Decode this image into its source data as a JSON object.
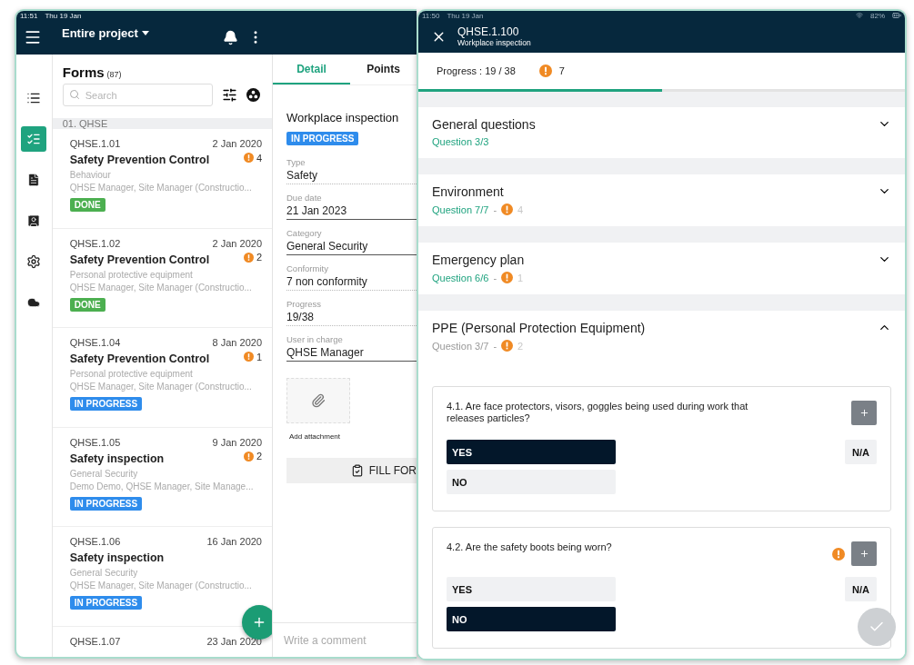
{
  "left_device": {
    "status_bar": {
      "time": "11:51",
      "date": "Thu 19 Jan"
    },
    "header": {
      "project": "Entire project"
    },
    "rail": [
      {
        "kind": "list",
        "selected": false
      },
      {
        "kind": "checklist",
        "selected": true
      },
      {
        "kind": "document",
        "selected": false
      },
      {
        "kind": "contact",
        "selected": false
      },
      {
        "kind": "settings",
        "selected": false
      },
      {
        "kind": "cloud",
        "selected": false
      }
    ],
    "forms": {
      "title": "Forms",
      "count": "(87)",
      "search": {
        "placeholder": "Search"
      },
      "group": "01. QHSE",
      "items": [
        {
          "code": "QHSE.1.01",
          "date": "2 Jan 2020",
          "title": "Safety Prevention Control",
          "warnings": "4",
          "category": "Behaviour",
          "assignees": "QHSE Manager, Site Manager (Constructio...",
          "status": {
            "kind": "done",
            "label": "DONE"
          }
        },
        {
          "code": "QHSE.1.02",
          "date": "2 Jan 2020",
          "title": "Safety Prevention Control",
          "warnings": "2",
          "category": "Personal protective equipment",
          "assignees": "QHSE Manager, Site Manager (Constructio...",
          "status": {
            "kind": "done",
            "label": "DONE"
          }
        },
        {
          "code": "QHSE.1.04",
          "date": "8 Jan 2020",
          "title": "Safety Prevention Control",
          "warnings": "1",
          "category": "Personal protective equipment",
          "assignees": "QHSE Manager, Site Manager (Constructio...",
          "status": {
            "kind": "in_progress",
            "label": "IN PROGRESS"
          }
        },
        {
          "code": "QHSE.1.05",
          "date": "9 Jan 2020",
          "title": "Safety inspection",
          "warnings": "2",
          "category": "General Security",
          "assignees": "Demo Demo, QHSE Manager, Site Manage...",
          "status": {
            "kind": "in_progress",
            "label": "IN PROGRESS"
          }
        },
        {
          "code": "QHSE.1.06",
          "date": "16 Jan 2020",
          "title": "Safety inspection",
          "category": "General Security",
          "assignees": "QHSE Manager, Site Manager (Constructio...",
          "status": {
            "kind": "in_progress",
            "label": "IN PROGRESS"
          }
        },
        {
          "code": "QHSE.1.07",
          "date": "23 Jan 2020"
        }
      ]
    },
    "detail": {
      "tabs": [
        {
          "label": "Detail",
          "selected": true
        },
        {
          "label": "Points",
          "selected": false
        }
      ],
      "title": "Workplace inspection",
      "status": {
        "kind": "in_progress",
        "label": "IN PROGRESS"
      },
      "fields": [
        {
          "label": "Type",
          "value": "Safety",
          "editable": false
        },
        {
          "label": "Due date",
          "value": "21 Jan 2023",
          "editable": true
        },
        {
          "label": "Category",
          "value": "General Security",
          "editable": true
        },
        {
          "label": "Conformity",
          "value": "7 non conformity",
          "editable": false
        },
        {
          "label": "Progress",
          "value": "19/38",
          "editable": false
        },
        {
          "label": "User in charge",
          "value": "QHSE Manager",
          "editable": true
        }
      ],
      "attachment": "Add attachment",
      "fill_button": "FILL FOR",
      "comment": {
        "placeholder": "Write a comment"
      }
    }
  },
  "right_device": {
    "status_bar": {
      "time": "11:50",
      "date": "Thu 19 Jan",
      "battery": "82%"
    },
    "header": {
      "title": "QHSE.1.100",
      "subtitle": "Workplace inspection"
    },
    "progress": {
      "label": "Progress : 19 / 38",
      "warnings": "7",
      "level": 0.5
    },
    "sections": [
      {
        "title": "General questions",
        "progress": "Question 3/3",
        "complete": true,
        "expanded": false
      },
      {
        "title": "Environment",
        "progress": "Question 7/7",
        "complete": true,
        "separator": "-",
        "warnings": "4",
        "expanded": false
      },
      {
        "title": "Emergency plan",
        "progress": "Question 6/6",
        "complete": true,
        "separator": "-",
        "warnings": "1",
        "expanded": false
      },
      {
        "title": "PPE (Personal Protection Equipment)",
        "progress": "Question 3/7",
        "complete": false,
        "separator": "-",
        "warnings": "2",
        "expanded": true,
        "questions": [
          {
            "text": "4.1. Are face protectors, visors, goggles being used during work that releases particles?",
            "warning": false,
            "options": [
              {
                "label": "YES",
                "selected": true
              },
              {
                "label": "NO",
                "selected": false
              }
            ],
            "na": {
              "label": "N/A",
              "selected": false
            }
          },
          {
            "text": "4.2. Are the safety boots being worn?",
            "warning": true,
            "options": [
              {
                "label": "YES",
                "selected": false
              },
              {
                "label": "NO",
                "selected": true
              }
            ],
            "na": {
              "label": "N/A",
              "selected": false
            }
          }
        ]
      }
    ],
    "submit": {
      "disabled": true
    }
  }
}
